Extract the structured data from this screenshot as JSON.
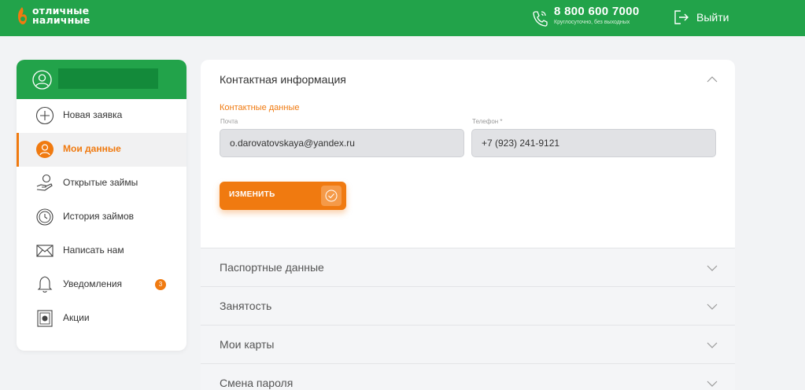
{
  "header": {
    "logo_line1": "отличные",
    "logo_line2": "наличные",
    "phone": "8 800 600 7000",
    "phone_note": "Круглосуточно, без выходных",
    "logout_label": "Выйти"
  },
  "sidebar": {
    "items": [
      {
        "label": "Новая заявка",
        "icon": "plus-circle-icon"
      },
      {
        "label": "Мои данные",
        "icon": "user-icon",
        "active": true
      },
      {
        "label": "Открытые займы",
        "icon": "coin-hand-icon"
      },
      {
        "label": "История займов",
        "icon": "clock-icon"
      },
      {
        "label": "Написать нам",
        "icon": "envelope-icon"
      },
      {
        "label": "Уведомления",
        "icon": "bell-icon",
        "badge": "3"
      },
      {
        "label": "Акции",
        "icon": "coupon-icon"
      }
    ]
  },
  "main": {
    "contact_section_title": "Контактная информация",
    "contact_subtitle": "Контактные данные",
    "email_label": "Почта",
    "email_value": "o.darovatovskaya@yandex.ru",
    "phone_label": "Телефон *",
    "phone_value": "+7 (923) 241-9121",
    "change_button": "ИЗМЕНИТЬ",
    "accordion": [
      {
        "title": "Паспортные данные"
      },
      {
        "title": "Занятость"
      },
      {
        "title": "Мои карты"
      },
      {
        "title": "Смена пароля"
      }
    ]
  },
  "colors": {
    "brand_green": "#22a34a",
    "accent_orange": "#f07a10"
  }
}
